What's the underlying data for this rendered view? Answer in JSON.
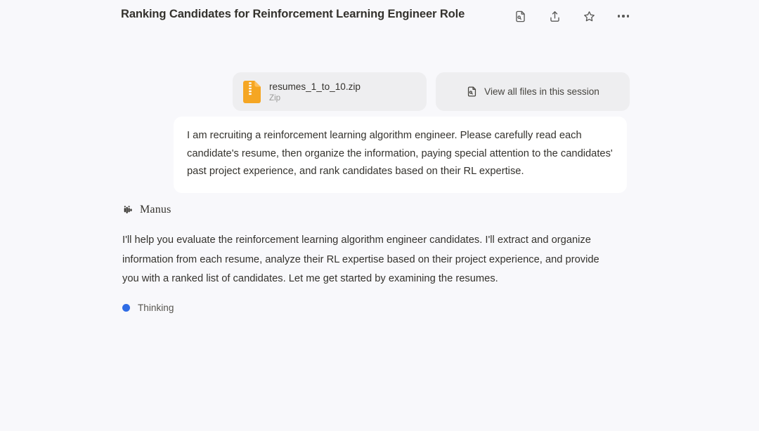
{
  "header": {
    "title": "Ranking Candidates for Reinforcement Learning Engineer Role",
    "actions": [
      {
        "name": "file-search-icon",
        "label": "View files"
      },
      {
        "name": "share-icon",
        "label": "Share"
      },
      {
        "name": "star-icon",
        "label": "Favorite"
      },
      {
        "name": "more-options-icon",
        "label": "More"
      }
    ]
  },
  "attachment": {
    "file_name": "resumes_1_to_10.zip",
    "file_type": "Zip",
    "icon": "zip-file-icon",
    "view_all_label": "View all files in this session",
    "view_all_icon": "file-search-icon",
    "accent_color": "#f5a623"
  },
  "user_message": {
    "text": "I am recruiting a reinforcement learning algorithm engineer. Please carefully read each candidate's resume, then organize the information, paying special attention to the candidates' past project experience, and rank candidates based on their RL expertise."
  },
  "assistant": {
    "brand_name": "Manus",
    "brand_icon": "manus-logo-icon",
    "text": "I'll help you evaluate the reinforcement learning algorithm engineer candidates. I'll extract and organize information from each resume, analyze their RL expertise based on their project experience, and provide you with a ranked list of candidates. Let me get started by examining the resumes.",
    "status_label": "Thinking",
    "status_color": "#2f6ce5"
  },
  "theme": {
    "background": "#f8f8fb",
    "card_background": "#eeeef0",
    "bubble_background": "#ffffff",
    "text_primary": "#34322d",
    "text_muted": "#9a9a98"
  }
}
